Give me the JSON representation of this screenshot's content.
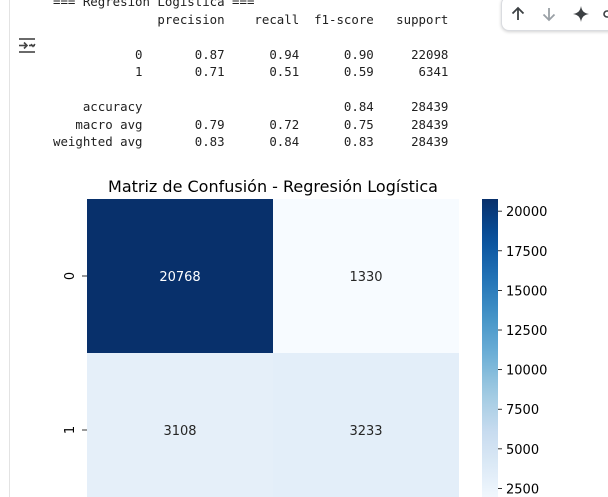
{
  "toolbar": {
    "move_up_icon": "arrow-up-icon",
    "move_down_icon": "arrow-down-icon",
    "gemini_icon": "sparkle-icon"
  },
  "output_toggle_icon": "output-toggle-icon",
  "report": {
    "lines": [
      "=== Regresion Logistica ===",
      "              precision    recall  f1-score   support",
      "",
      "           0       0.87      0.94      0.90     22098",
      "           1       0.71      0.51      0.59      6341",
      "",
      "    accuracy                           0.84     28439",
      "   macro avg       0.79      0.72      0.75     28439",
      "weighted avg       0.83      0.84      0.83     28439"
    ]
  },
  "chart_data": {
    "type": "heatmap",
    "title": "Matriz de Confusión - Regresión Logística",
    "row_labels": [
      "0",
      "1"
    ],
    "col_labels": [],
    "values": [
      [
        20768,
        1330
      ],
      [
        3108,
        3233
      ]
    ],
    "colormap": "Blues",
    "colorbar": {
      "ticks": [
        20000,
        17500,
        15000,
        12500,
        10000,
        7500,
        5000,
        2500
      ],
      "tick_labels": [
        "20000",
        "17500",
        "15000",
        "12500",
        "10000",
        "7500",
        "5000",
        "2500"
      ],
      "range": [
        1330,
        20768
      ]
    },
    "colors": {
      "max": "#08306b",
      "min": "#f7fbff"
    }
  }
}
